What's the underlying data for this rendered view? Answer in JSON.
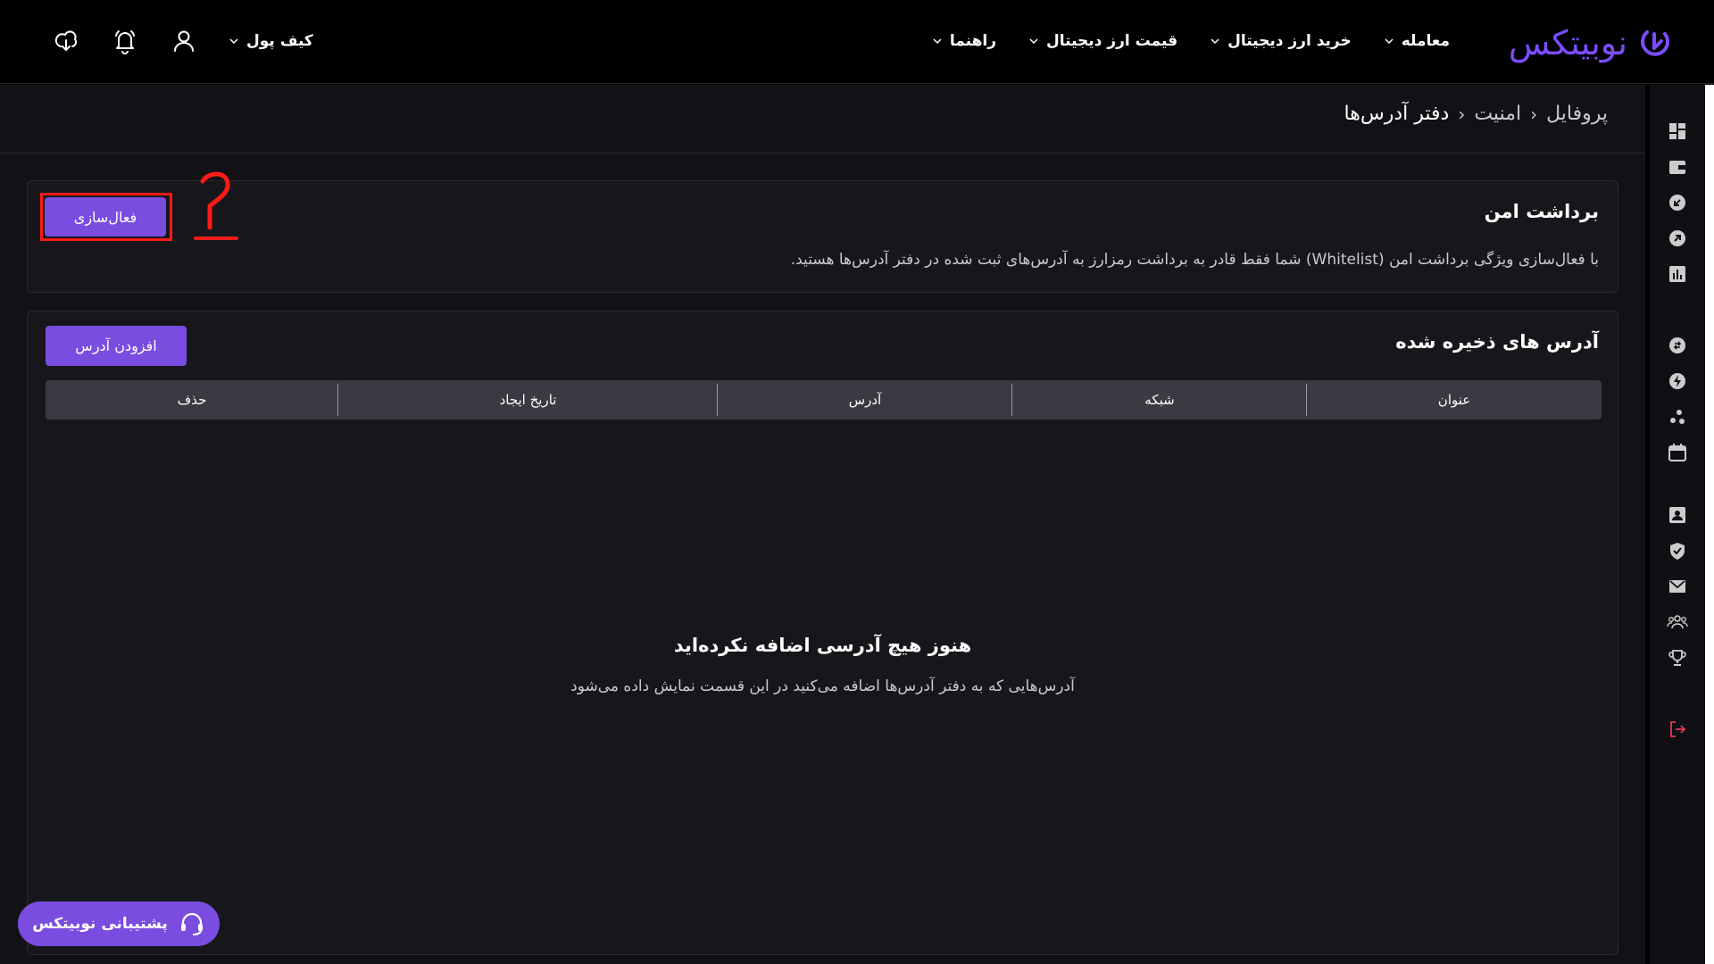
{
  "brand": {
    "name": "نوبیتکس",
    "color": "#7c4dff"
  },
  "nav": {
    "items": [
      {
        "label": "معامله"
      },
      {
        "label": "خرید ارز دیجیتال"
      },
      {
        "label": "قیمت ارز دیجیتال"
      },
      {
        "label": "راهنما"
      }
    ],
    "wallet_label": "کیف پول",
    "icons": [
      "user-icon",
      "bell-icon",
      "download-icon"
    ]
  },
  "breadcrumb": {
    "items": [
      "پروفایل",
      "امنیت",
      "دفتر آدرس‌ها"
    ]
  },
  "secure_withdraw": {
    "title": "برداشت امن",
    "description": "با فعال‌سازی ویژگی برداشت امن (Whitelist) شما فقط قادر به برداشت رمزارز به آدرس‌های ثبت شده در دفتر آدرس‌ها هستید.",
    "activate_label": "فعال‌سازی",
    "annotation_number": "۲"
  },
  "saved_addresses": {
    "title": "آدرس های ذخیره شده",
    "add_label": "افزودن آدرس",
    "columns": [
      "عنوان",
      "شبکه",
      "آدرس",
      "تاریخ ایجاد",
      "حذف"
    ],
    "empty_title": "هنوز هیچ آدرسی اضافه نکرده‌اید",
    "empty_desc": "آدرس‌هایی که به دفتر آدرس‌ها اضافه می‌کنید در این قسمت نمایش داده می‌شود"
  },
  "support": {
    "label": "پشتیبانی نوبیتکس"
  },
  "sidebar": {
    "icons": [
      "dashboard-icon",
      "wallet-icon",
      "deposit-icon",
      "withdraw-icon",
      "chart-icon",
      "trade-icon",
      "lightning-icon",
      "dots-icon",
      "calendar-icon",
      "profile-icon",
      "shield-icon",
      "mail-icon",
      "users-icon",
      "trophy-icon",
      "logout-icon"
    ]
  },
  "colors": {
    "accent": "#7a4de0",
    "annotation": "#ff1a1a",
    "logout": "#e53950"
  }
}
